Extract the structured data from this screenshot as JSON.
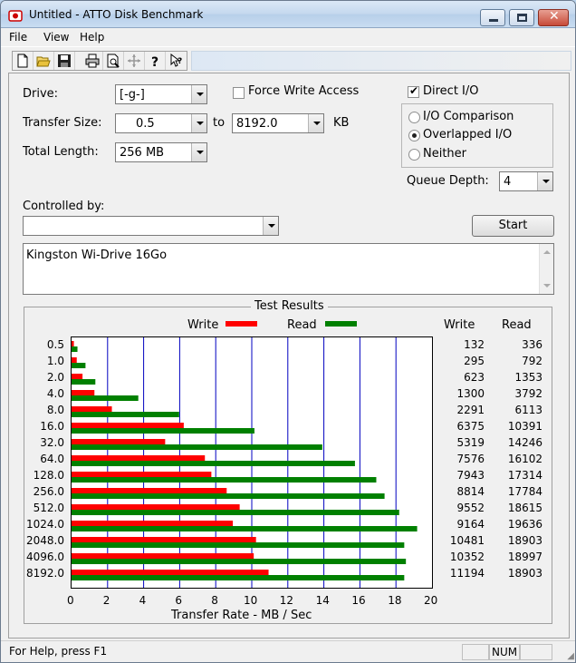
{
  "window": {
    "title": "Untitled - ATTO Disk Benchmark"
  },
  "menu": [
    "File",
    "View",
    "Help"
  ],
  "form": {
    "drive_label": "Drive:",
    "drive_value": "[-g-]",
    "force_write_label": "Force Write Access",
    "direct_io_label": "Direct I/O",
    "transfer_size_label": "Transfer Size:",
    "transfer_from": "0.5",
    "to_label": "to",
    "transfer_to": "8192.0",
    "kb_label": "KB",
    "total_length_label": "Total Length:",
    "total_length_value": "256 MB",
    "io_comparison_label": "I/O Comparison",
    "overlapped_io_label": "Overlapped I/O",
    "neither_label": "Neither",
    "queue_depth_label": "Queue Depth:",
    "queue_depth_value": "4",
    "controlled_by_label": "Controlled by:",
    "controlled_by_value": "",
    "start_label": "Start",
    "description": "Kingston Wi-Drive 16Go"
  },
  "results": {
    "title": "Test Results",
    "legend_write": "Write",
    "legend_read": "Read",
    "col_write": "Write",
    "col_read": "Read",
    "write_color": "#ff0000",
    "read_color": "#008000"
  },
  "chart_data": {
    "type": "bar",
    "orientation": "horizontal",
    "xlabel": "Transfer Rate - MB / Sec",
    "xlim": [
      0,
      20
    ],
    "xticks": [
      "0",
      "2",
      "4",
      "6",
      "8",
      "10",
      "12",
      "14",
      "16",
      "18",
      "20"
    ],
    "grid": true,
    "categories": [
      "0.5",
      "1.0",
      "2.0",
      "4.0",
      "8.0",
      "16.0",
      "32.0",
      "64.0",
      "128.0",
      "256.0",
      "512.0",
      "1024.0",
      "2048.0",
      "4096.0",
      "8192.0"
    ],
    "series": [
      {
        "name": "Write",
        "values": [
          132,
          295,
          623,
          1300,
          2291,
          6375,
          5319,
          7576,
          7943,
          8814,
          9552,
          9164,
          10481,
          10352,
          11194
        ]
      },
      {
        "name": "Read",
        "values": [
          336,
          792,
          1353,
          3792,
          6113,
          10391,
          14246,
          16102,
          17314,
          17784,
          18615,
          19636,
          18903,
          18997,
          18903
        ]
      }
    ]
  },
  "status": {
    "help_text": "For Help, press F1",
    "num": "NUM"
  }
}
